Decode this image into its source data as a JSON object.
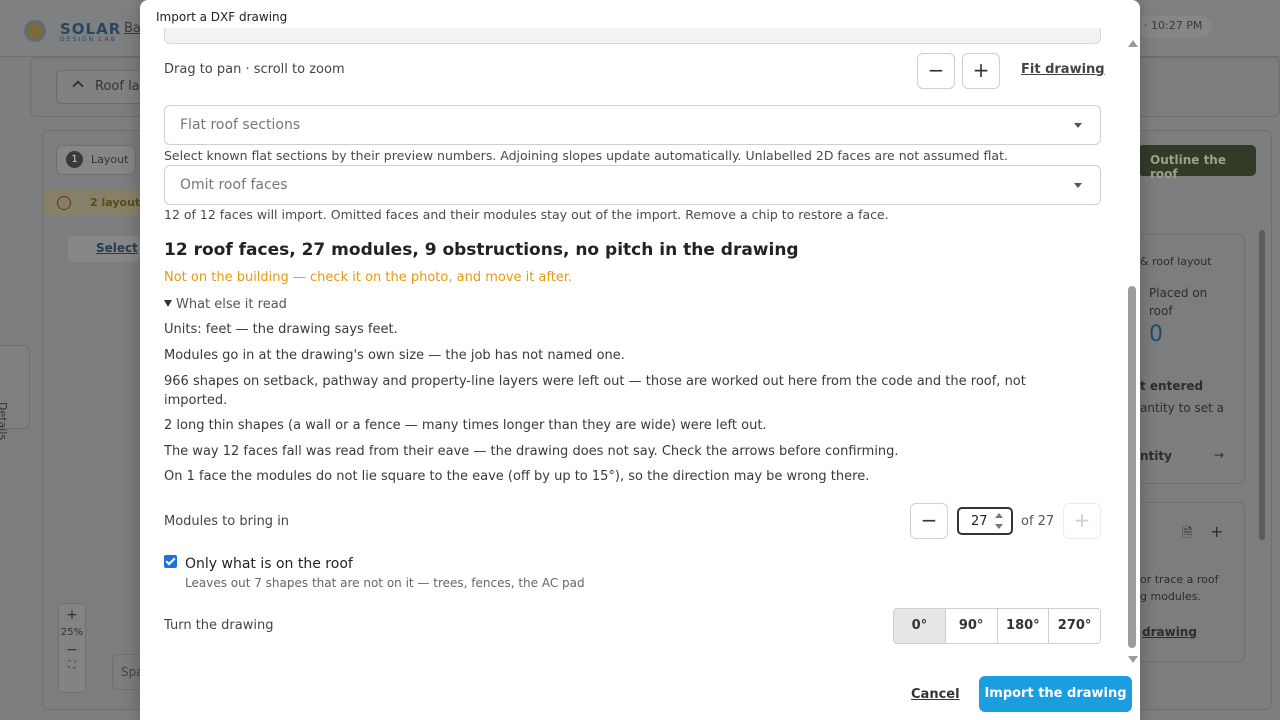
{
  "background": {
    "brand": "SOLAR",
    "brand_sub": "DESIGN LAB",
    "back_link": "Ba",
    "time": "· 10:27 PM",
    "roof_button": "Roof lay",
    "tab_number": "1",
    "tab_label": "Layout",
    "warning": "2 layout",
    "select_tool": "Select",
    "outline_button": "Outline the roof",
    "details_label": "Details",
    "right_panel": {
      "section_label": "& roof layout",
      "placed_label": "Placed on",
      "placed_label2": "roof",
      "placed_value": "0",
      "not_entered": "t entered",
      "quantity_hint": "antity to set a",
      "quantity_link": "ntity",
      "trace_hint1": "or trace a roof",
      "trace_hint2": "g modules.",
      "drawing_link": "drawing"
    },
    "zoom_plus": "+",
    "zoom_level": "25%",
    "zoom_minus": "−",
    "search_stub": "Spa"
  },
  "modal": {
    "title": "Import a DXF drawing",
    "pan_hint": "Drag to pan · scroll to zoom",
    "zoom_out": "−",
    "zoom_in": "+",
    "fit_link": "Fit drawing",
    "flat_select_placeholder": "Flat roof sections",
    "flat_hint": "Select known flat sections by their preview numbers. Adjoining slopes update automatically. Unlabelled 2D faces are not assumed flat.",
    "omit_select_placeholder": "Omit roof faces",
    "omit_hint": "12 of 12 faces will import. Omitted faces and their modules stay out of the import. Remove a chip to restore a face.",
    "heading": "12 roof faces, 27 modules, 9 obstructions, no pitch in the drawing",
    "warning": "Not on the building — check it on the photo, and move it after.",
    "details_summary": "What else it read",
    "details": [
      "Units: feet — the drawing says feet.",
      "Modules go in at the drawing's own size — the job has not named one.",
      "966 shapes on setback, pathway and property-line layers were left out — those are worked out here from the code and the roof, not imported.",
      "2 long thin shapes (a wall or a fence — many times longer than they are wide) were left out.",
      "The way 12 faces fall was read from their eave — the drawing does not say. Check the arrows before confirming.",
      "On 1 face the modules do not lie square to the eave (off by up to 15°), so the direction may be wrong there."
    ],
    "modules_label": "Modules to bring in",
    "modules_minus": "−",
    "modules_value": "27",
    "modules_of": "of 27",
    "modules_plus": "+",
    "roof_only_label": "Only what is on the roof",
    "roof_only_hint": "Leaves out 7 shapes that are not on it — trees, fences, the AC pad",
    "roof_only_checked": true,
    "turn_label": "Turn the drawing",
    "rotations": [
      "0°",
      "90°",
      "180°",
      "270°"
    ],
    "cancel": "Cancel",
    "import": "Import the drawing"
  },
  "colors": {
    "primary": "#1a9ee0",
    "warning": "#e39a13",
    "checkbox": "#1e73d6"
  }
}
